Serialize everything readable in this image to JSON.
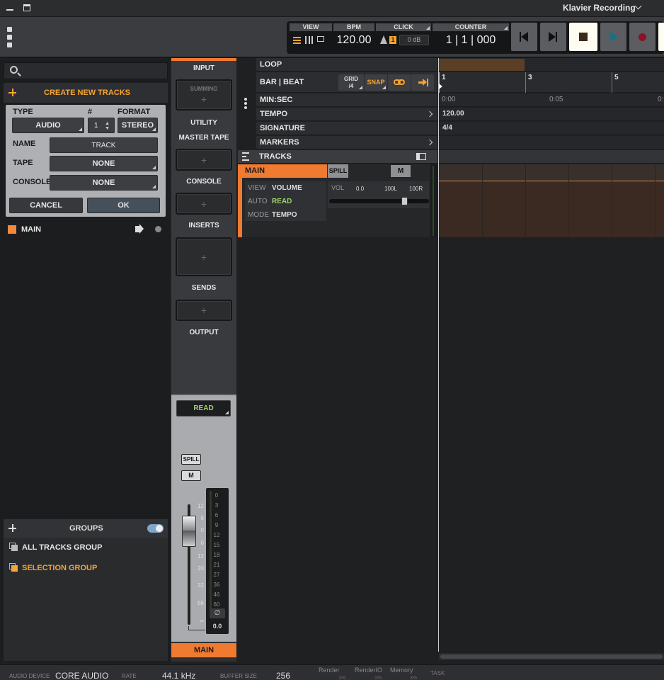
{
  "window": {
    "title": "Klavier Recording"
  },
  "transport": {
    "view_label": "VIEW",
    "bpm_label": "BPM",
    "bpm_value": "120.00",
    "click_label": "CLICK",
    "click_badge": "1",
    "click_level": "0 dB",
    "counter_label": "COUNTER",
    "counter_value": "1 | 1 | 000"
  },
  "browser": {
    "search_placeholder": "",
    "create_label": "CREATE NEW TRACKS",
    "type_label": "TYPE",
    "count_label": "#",
    "format_label": "FORMAT",
    "type_value": "AUDIO",
    "count_value": "1",
    "format_value": "STEREO",
    "name_label": "NAME",
    "name_value": "TRACK",
    "tape_label": "TAPE",
    "tape_value": "NONE",
    "console_label": "CONSOLE",
    "console_value": "NONE",
    "cancel": "CANCEL",
    "ok": "OK",
    "track_name": "MAIN",
    "accent_color": "#f7a534",
    "groups_label": "GROUPS",
    "groups": [
      {
        "label": "ALL TRACKS GROUP",
        "color": "#e6e6e6"
      },
      {
        "label": "SELECTION GROUP",
        "color": "#f7a534"
      }
    ]
  },
  "channel": {
    "input": "INPUT",
    "summing": "SUMMING",
    "utility": "UTILITY",
    "master_tape": "MASTER TAPE",
    "console": "CONSOLE",
    "inserts": "INSERTS",
    "sends": "SENDS",
    "output": "OUTPUT",
    "automation": "READ",
    "spill": "SPILL",
    "mute": "M",
    "fader_scale": [
      "12",
      "6",
      "0",
      "6",
      "12",
      "20",
      "32",
      "56",
      "∞"
    ],
    "meter_scale": [
      "0",
      "3",
      "6",
      "9",
      "12",
      "15",
      "18",
      "21",
      "27",
      "36",
      "46",
      "60"
    ],
    "phase": "∅",
    "peak": "0.0",
    "name": "MAIN"
  },
  "ruler": {
    "loop": "LOOP",
    "bar_beat": "BAR | BEAT",
    "grid_label": "GRID",
    "grid_value": "/4",
    "snap": "SNAP",
    "min_sec": "MIN:SEC",
    "tempo": "TEMPO",
    "tempo_value": "120.00",
    "signature": "SIGNATURE",
    "signature_value": "4/4",
    "markers": "MARKERS",
    "tracks": "TRACKS",
    "bars": [
      "1",
      "3",
      "5"
    ],
    "times": [
      "0:00",
      "0:05",
      "0:"
    ]
  },
  "track": {
    "name": "MAIN",
    "spill": "SPILL",
    "mute": "M",
    "view_label": "VIEW",
    "view_value": "VOLUME",
    "auto_label": "AUTO",
    "auto_value": "READ",
    "mode_label": "MODE",
    "mode_value": "TEMPO",
    "vol_label": "VOL",
    "vol_value": "0.0",
    "pan_left": "100L",
    "pan_right": "100R"
  },
  "status": {
    "device_label": "AUDIO DEVICE",
    "device_value": "CORE AUDIO",
    "rate_label": "RATE",
    "rate_value": "44.1 kHz",
    "buffer_label": "BUFFER SIZE",
    "buffer_value": "256",
    "render_label": "Render",
    "render_value": "1%",
    "renderio_label": "RenderIO",
    "renderio_value": "1%",
    "memory_label": "Memory",
    "memory_value": "3%",
    "task_label": "TASK"
  }
}
